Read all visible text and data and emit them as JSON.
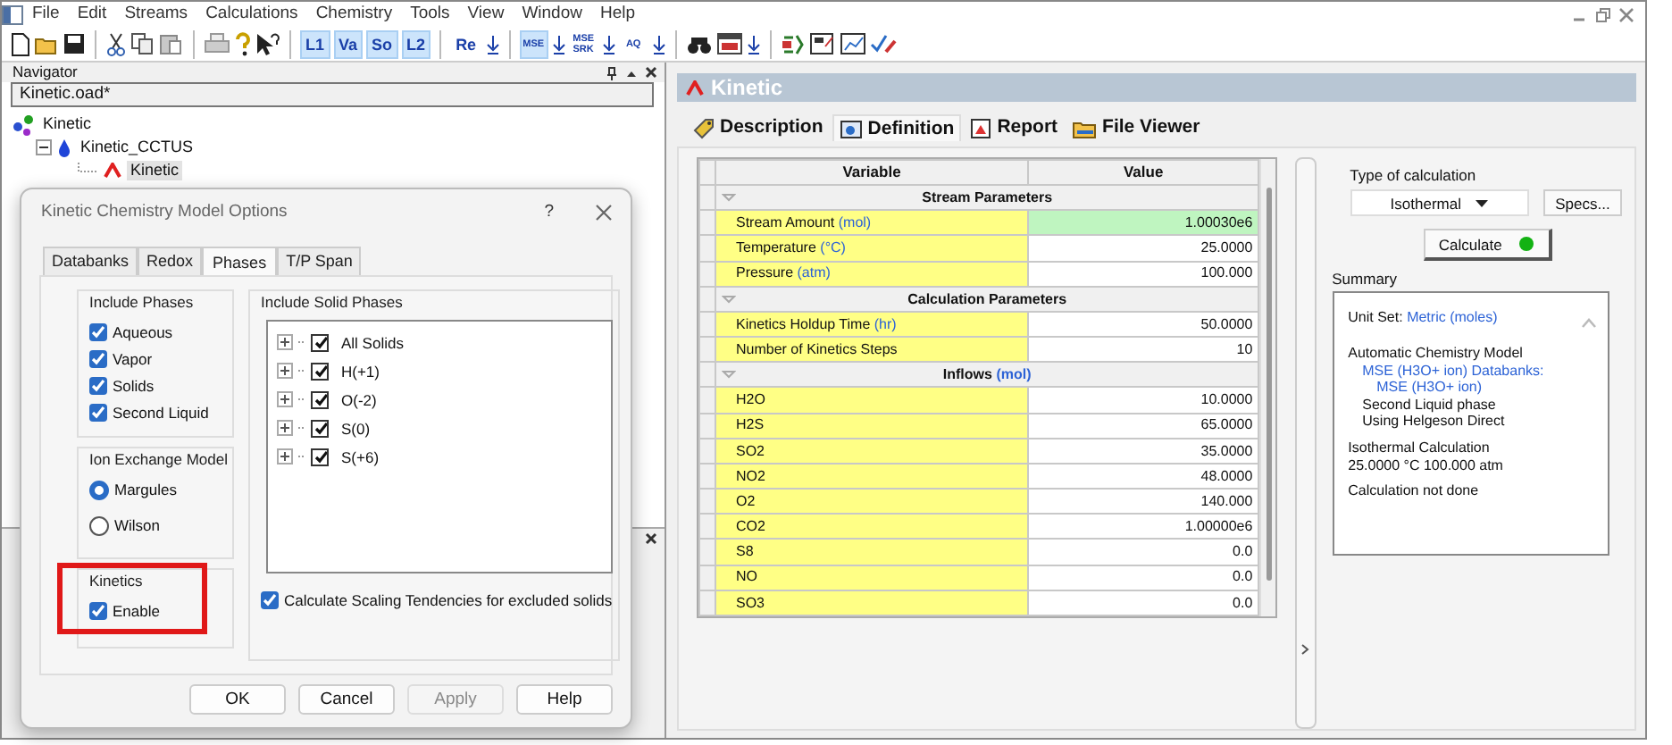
{
  "menu": [
    "File",
    "Edit",
    "Streams",
    "Calculations",
    "Chemistry",
    "Tools",
    "View",
    "Window",
    "Help"
  ],
  "toolbar": [
    {
      "label": "L1",
      "pressed": true
    },
    {
      "label": "Va",
      "pressed": true
    },
    {
      "label": "So",
      "pressed": true
    },
    {
      "label": "L2",
      "pressed": true
    },
    {
      "label": "Re",
      "pressed": false
    },
    {
      "label": "MSE",
      "pressed": true
    },
    {
      "label": "MSE SRK",
      "pressed": false
    },
    {
      "label": "AQ",
      "pressed": false
    }
  ],
  "navigator": {
    "title": "Navigator",
    "file": "Kinetic.oad*",
    "tree": [
      {
        "label": "Kinetic",
        "selected": false,
        "children": [
          {
            "label": "Kinetic_CCTUS",
            "selected": false,
            "expanded": true,
            "children": [
              {
                "label": "Kinetic",
                "selected": true
              }
            ]
          }
        ]
      }
    ]
  },
  "dialog": {
    "title": "Kinetic  Chemistry Model Options",
    "help": "?",
    "tabs": [
      {
        "label": "Databanks",
        "selected": false
      },
      {
        "label": "Redox",
        "selected": false
      },
      {
        "label": "Phases",
        "selected": true
      },
      {
        "label": "T/P Span",
        "selected": false
      }
    ],
    "phases": {
      "title": "Include Phases",
      "items": [
        {
          "label": "Aqueous",
          "checked": true
        },
        {
          "label": "Vapor",
          "checked": true
        },
        {
          "label": "Solids",
          "checked": true
        },
        {
          "label": "Second Liquid",
          "checked": true
        }
      ]
    },
    "ion_exchange": {
      "title": "Ion Exchange Model",
      "options": [
        {
          "label": "Margules",
          "selected": true
        },
        {
          "label": "Wilson",
          "selected": false
        }
      ]
    },
    "kinetics": {
      "title": "Kinetics",
      "highlighted": true,
      "items": [
        {
          "label": "Enable",
          "checked": true
        }
      ]
    },
    "solid_phases": {
      "title": "Include Solid Phases",
      "items": [
        {
          "label": "All Solids",
          "checked": true
        },
        {
          "label": "H(+1)",
          "checked": true
        },
        {
          "label": "O(-2)",
          "checked": true
        },
        {
          "label": "S(0)",
          "checked": true
        },
        {
          "label": "S(+6)",
          "checked": true
        }
      ]
    },
    "scaling": {
      "label": "Calculate Scaling Tendencies for excluded solids",
      "checked": true
    },
    "buttons": [
      {
        "label": "OK",
        "disabled": false
      },
      {
        "label": "Cancel",
        "disabled": false
      },
      {
        "label": "Apply",
        "disabled": true
      },
      {
        "label": "Help",
        "disabled": false
      }
    ]
  },
  "editor": {
    "title": "Kinetic",
    "tabs": [
      {
        "label": "Description",
        "selected": false
      },
      {
        "label": "Definition",
        "selected": true
      },
      {
        "label": "Report",
        "selected": false
      },
      {
        "label": "File Viewer",
        "selected": false
      }
    ],
    "table": {
      "columns": [
        "Variable",
        "Value"
      ],
      "sections": [
        {
          "title": "Stream Parameters",
          "rows": [
            {
              "label": "Stream Amount",
              "unit": "(mol)",
              "value": "1.00030e6",
              "highlighted": true
            },
            {
              "label": "Temperature",
              "unit": "(°C)",
              "value": "25.0000",
              "highlighted": false
            },
            {
              "label": "Pressure",
              "unit": "(atm)",
              "value": "100.000",
              "highlighted": false
            }
          ]
        },
        {
          "title": "Calculation Parameters",
          "rows": [
            {
              "label": "Kinetics Holdup Time",
              "unit": "(hr)",
              "value": "50.0000",
              "highlighted": false
            },
            {
              "label": "Number of Kinetics Steps",
              "value": "10",
              "highlighted": false
            }
          ]
        },
        {
          "title": "Inflows",
          "unit": "(mol)",
          "rows": [
            {
              "label": "H2O",
              "value": "10.0000",
              "highlighted": false
            },
            {
              "label": "H2S",
              "value": "65.0000",
              "highlighted": false
            },
            {
              "label": "SO2",
              "value": "35.0000",
              "highlighted": false
            },
            {
              "label": "NO2",
              "value": "48.0000",
              "highlighted": false
            },
            {
              "label": "O2",
              "value": "140.000",
              "highlighted": false
            },
            {
              "label": "CO2",
              "value": "1.00000e6",
              "highlighted": false
            },
            {
              "label": "S8",
              "value": "0.0",
              "highlighted": false
            },
            {
              "label": "NO",
              "value": "0.0",
              "highlighted": false
            },
            {
              "label": "SO3",
              "value": "0.0",
              "highlighted": false
            }
          ]
        }
      ]
    },
    "calc": {
      "type_label": "Type of calculation",
      "type": "Isothermal",
      "specs": "Specs...",
      "calculate": "Calculate"
    },
    "summary": {
      "title": "Summary",
      "unit_set": {
        "label": "Unit Set:",
        "value": "Metric (moles)"
      },
      "model": {
        "title": "Automatic Chemistry Model",
        "children": [
          {
            "text": "MSE (H3O+ ion) Databanks:",
            "kind": "link",
            "children": [
              {
                "text": "MSE (H3O+ ion)",
                "kind": "link"
              }
            ]
          },
          {
            "text": "Second Liquid phase",
            "kind": "plain"
          },
          {
            "text": "Using Helgeson Direct",
            "kind": "plain"
          }
        ]
      },
      "conditions": [
        "Isothermal Calculation",
        "25.0000 °C 100.000 atm"
      ],
      "status": "Calculation not done"
    }
  }
}
